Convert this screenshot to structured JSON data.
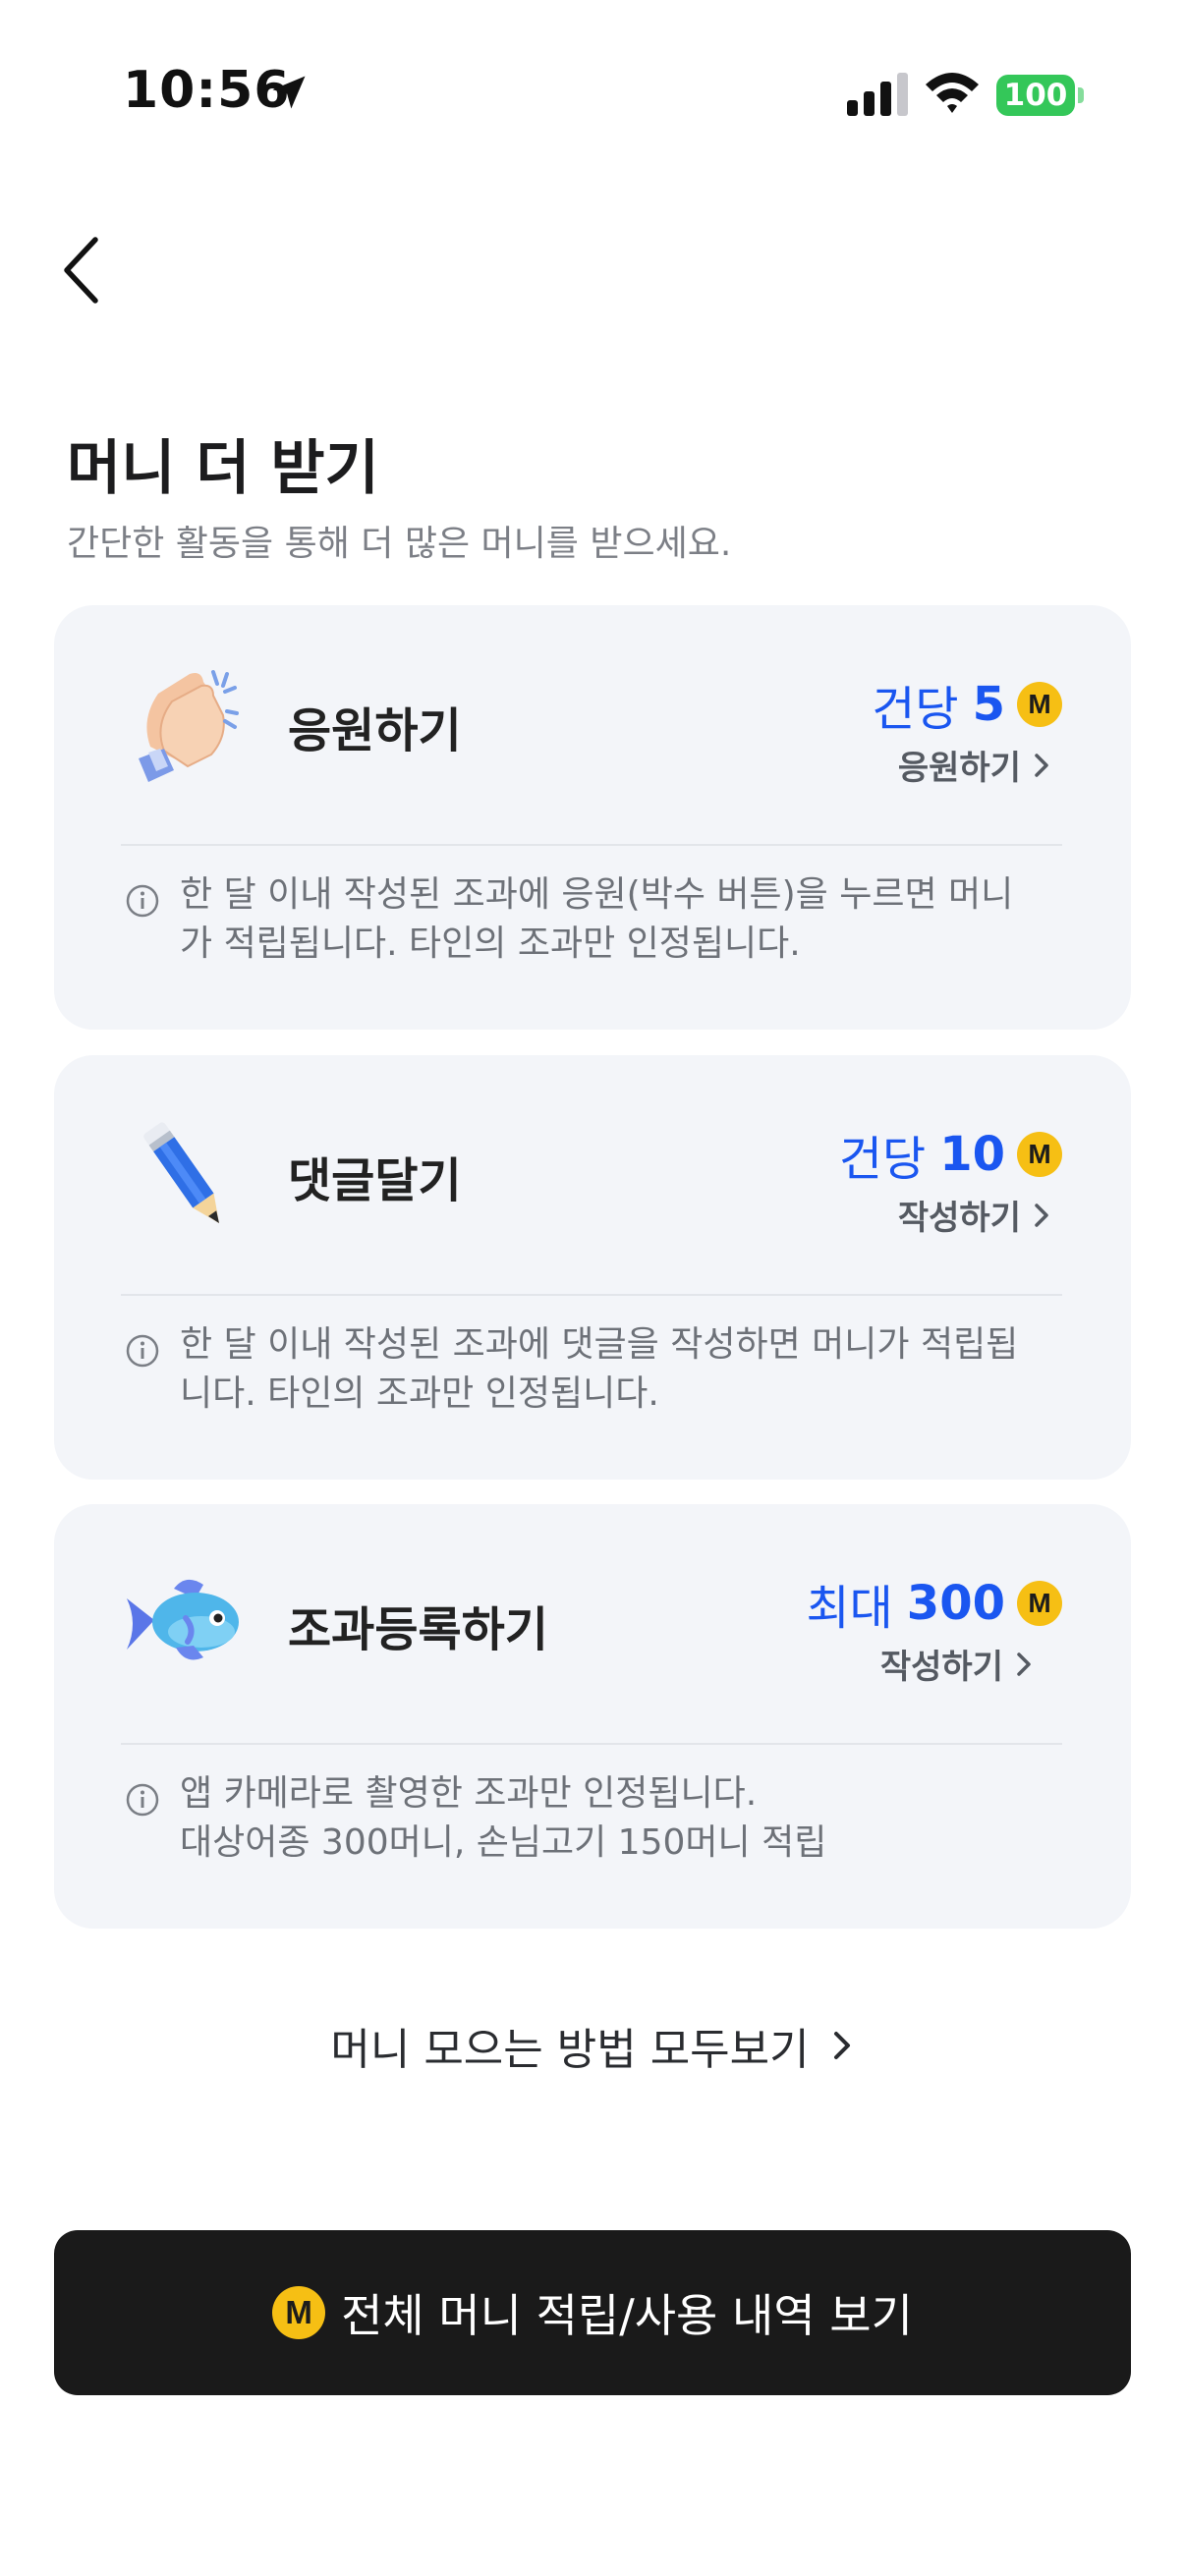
{
  "status_bar": {
    "time": "10:56",
    "battery": "100"
  },
  "header": {
    "title": "머니 더 받기",
    "subtitle": "간단한 활동을 통해 더 많은 머니를 받으세요."
  },
  "cards": [
    {
      "title": "응원하기",
      "reward_prefix": "건당",
      "reward_value": "5",
      "coin_label": "M",
      "action_label": "응원하기",
      "description": [
        "한 달 이내 작성된 조과에 응원(박수 버튼)을 누르면 머니",
        "가 적립됩니다. 타인의 조과만 인정됩니다."
      ],
      "icon": "clapping-hands-icon"
    },
    {
      "title": "댓글달기",
      "reward_prefix": "건당",
      "reward_value": "10",
      "coin_label": "M",
      "action_label": "작성하기",
      "description": [
        "한 달 이내 작성된 조과에 댓글을 작성하면 머니가 적립됩",
        "니다. 타인의 조과만 인정됩니다."
      ],
      "icon": "pencil-icon"
    },
    {
      "title": "조과등록하기",
      "reward_prefix": "최대",
      "reward_value": "300",
      "coin_label": "M",
      "action_label": "작성하기",
      "description": [
        "앱 카메라로 촬영한 조과만 인정됩니다.",
        "대상어종 300머니, 손님고기 150머니 적립"
      ],
      "icon": "fish-icon"
    }
  ],
  "all_ways_link": "머니 모으는 방법 모두보기",
  "history_button": {
    "coin_label": "M",
    "label": "전체 머니 적립/사용 내역 보기"
  },
  "colors": {
    "accent_blue": "#1a56f0",
    "coin_yellow": "#f6bf14",
    "card_bg": "#f3f5f9",
    "button_dark": "#1a1a1a",
    "battery_green": "#34c759"
  }
}
